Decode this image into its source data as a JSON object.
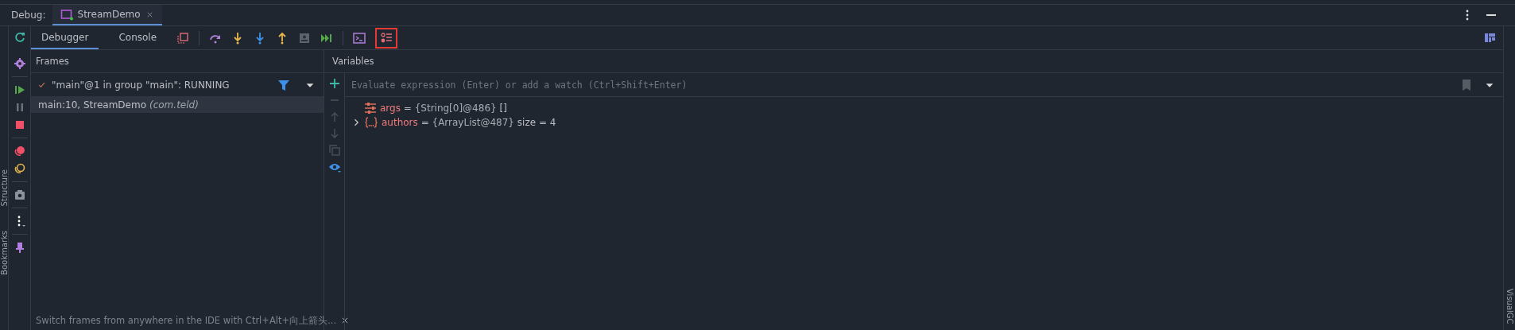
{
  "debug_bar": {
    "label": "Debug:",
    "tabs": [
      {
        "label": "StreamDemo",
        "selected": true
      }
    ]
  },
  "side_labels": {
    "left": [
      "Structure",
      "Bookmarks"
    ],
    "right": [
      "VisualGC"
    ]
  },
  "tabs": [
    {
      "label": "Debugger",
      "selected": true
    },
    {
      "label": "Console",
      "selected": false
    }
  ],
  "frames": {
    "title": "Frames",
    "thread": "\"main\"@1 in group \"main\": RUNNING",
    "items": [
      {
        "method": "main:10, StreamDemo",
        "package": "(com.teld)",
        "selected": true
      }
    ],
    "hint": "Switch frames from anywhere in the IDE with Ctrl+Alt+向上箭头..."
  },
  "variables": {
    "title": "Variables",
    "placeholder": "Evaluate expression (Enter) or add a watch (Ctrl+Shift+Enter)",
    "items": [
      {
        "kind": "array",
        "name": "args",
        "operator": "=",
        "ref": "{String[0]@486}",
        "value": "[]"
      },
      {
        "kind": "object",
        "name": "authors",
        "operator": "=",
        "ref": "{ArrayList@487}",
        "value": "size = 4",
        "expanded": false
      }
    ]
  }
}
